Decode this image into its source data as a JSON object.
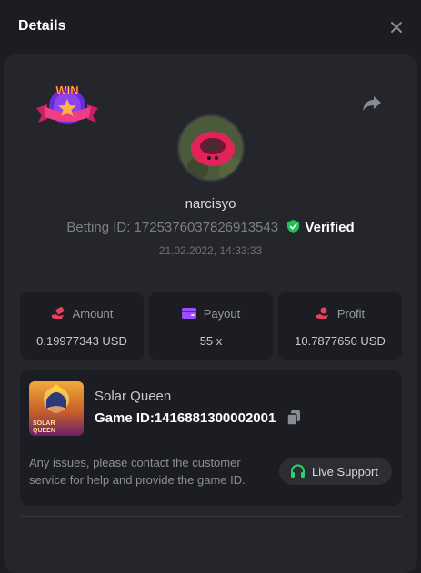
{
  "modal": {
    "title": "Details"
  },
  "player": {
    "username": "narcisyo",
    "betting_id_label": "Betting ID: 1725376037826913543",
    "verified_label": "Verified",
    "date": "21.02.2022, 14:33:33",
    "badge_text": "WIN"
  },
  "stats": [
    {
      "label": "Amount",
      "value": "0.19977343 USD",
      "icon": "money-hand-icon"
    },
    {
      "label": "Payout",
      "value": "55 x",
      "icon": "wallet-icon"
    },
    {
      "label": "Profit",
      "value": "10.7877650 USD",
      "icon": "coins-hand-icon"
    }
  ],
  "game": {
    "name": "Solar Queen",
    "id_label": "Game ID:1416881300002001",
    "thumb_text_line1": "SOLAR",
    "thumb_text_line2": "QUEEN",
    "help_text": "Any issues, please contact the customer service for help and provide the game ID.",
    "support_label": "Live Support"
  },
  "colors": {
    "background": "#1c1d22",
    "card": "#25262b",
    "accent_pink": "#e8415f",
    "accent_purple": "#9b4dff",
    "verified_green": "#21c15a",
    "support_green": "#2bd46b"
  }
}
